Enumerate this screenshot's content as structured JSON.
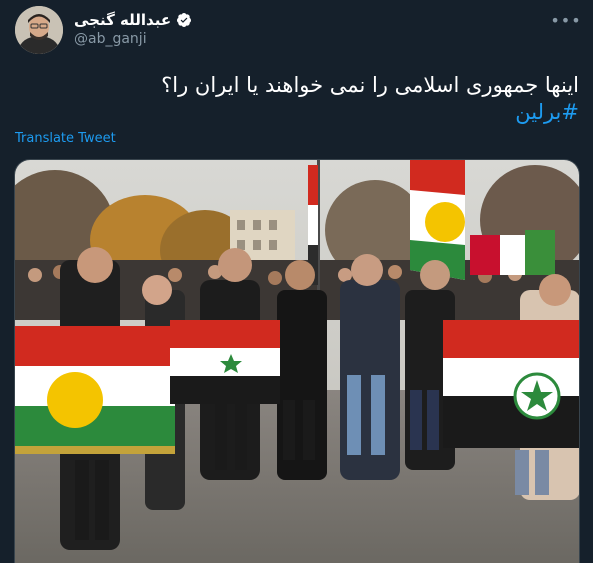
{
  "author": {
    "display_name": "عبدالله گنجی",
    "handle": "@ab_ganji",
    "verified": true
  },
  "tweet": {
    "text": "اینها جمهوری اسلامی را نمی خواهند یا ایران را؟",
    "hashtag": "#برلین",
    "translate_label": "Translate Tweet"
  },
  "icons": {
    "more": "more-options-icon",
    "verified": "verified-badge-icon"
  },
  "colors": {
    "background": "#15202b",
    "link": "#1d9bf0",
    "secondary_text": "#8899a6"
  }
}
